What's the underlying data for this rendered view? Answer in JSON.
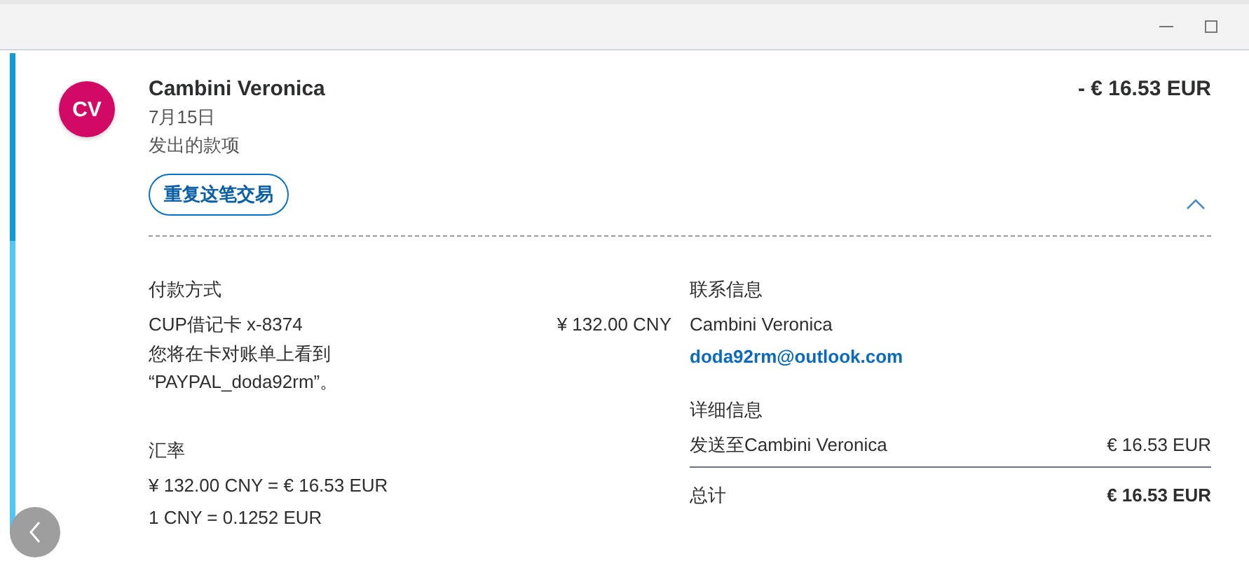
{
  "transaction": {
    "initials": "CV",
    "name": "Cambini Veronica",
    "date": "7月15日",
    "type": "发出的款项",
    "amount": "- € 16.53 EUR",
    "repeat_button": "重复这笔交易",
    "expanded": true
  },
  "payment": {
    "heading": "付款方式",
    "method": "CUP借记卡 x-8374",
    "method_amount": "¥ 132.00 CNY",
    "note": "您将在卡对账单上看到",
    "note_2": "“PAYPAL_doda92rm”。"
  },
  "exchange": {
    "heading": "汇率",
    "conversion": "¥ 132.00 CNY = € 16.53 EUR",
    "rate": "1 CNY = 0.1252 EUR"
  },
  "contact": {
    "heading": "联系信息",
    "name": "Cambini Veronica",
    "email": "doda92rm@outlook.com"
  },
  "details": {
    "heading": "详细信息",
    "rows": [
      {
        "label": "发送至Cambini Veronica",
        "value": "€ 16.53 EUR"
      }
    ],
    "total_label": "总计",
    "total_value": "€ 16.53 EUR"
  }
}
